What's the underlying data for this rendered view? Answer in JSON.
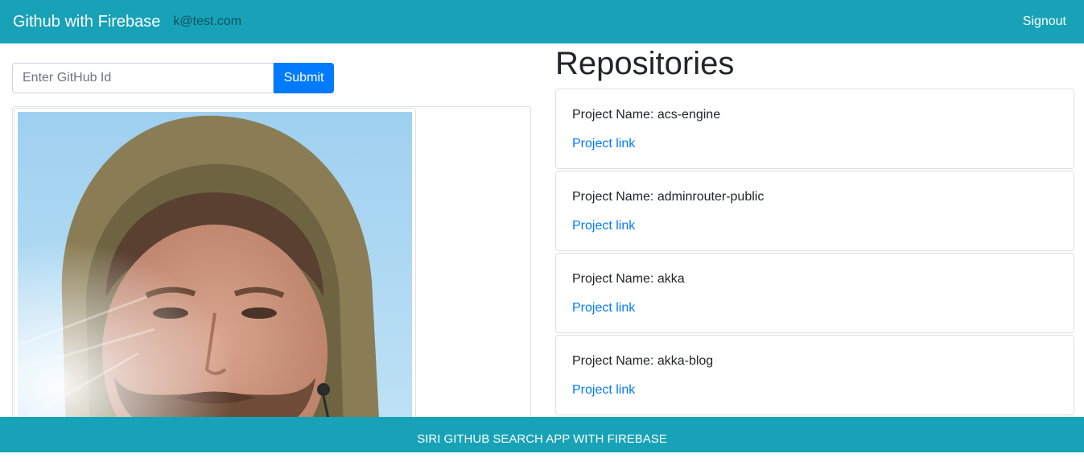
{
  "navbar": {
    "brand": "Github with Firebase",
    "user_email": "k@test.com",
    "signout_label": "Signout"
  },
  "search": {
    "placeholder": "Enter GitHub Id",
    "value": "",
    "submit_label": "Submit"
  },
  "profile": {
    "avatar_icon": "user-photo"
  },
  "repositories": {
    "title": "Repositories",
    "items": [
      {
        "name": "Project Name: acs-engine",
        "link_label": "Project link"
      },
      {
        "name": "Project Name: adminrouter-public",
        "link_label": "Project link"
      },
      {
        "name": "Project Name: akka",
        "link_label": "Project link"
      },
      {
        "name": "Project Name: akka-blog",
        "link_label": "Project link"
      }
    ]
  },
  "footer": {
    "text": "SIRI GITHUB SEARCH APP WITH FIREBASE"
  },
  "colors": {
    "navbar": "#17a2b8",
    "primary": "#007bff",
    "link": "#007bff"
  }
}
